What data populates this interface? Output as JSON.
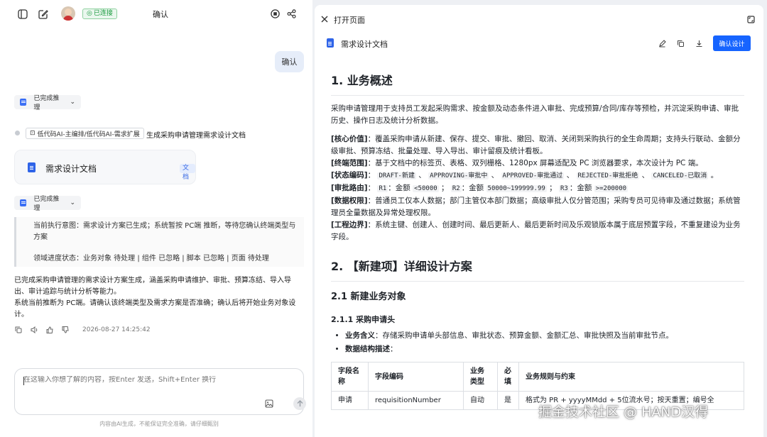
{
  "topbar": {
    "status": "已连接",
    "title": "确认"
  },
  "chat": {
    "user_message": "确认",
    "reasoning_label": "已完成推理",
    "step_tag": "低代码AI-主编排/低代码AI-需求扩展",
    "step_text": "生成采购申请管理需求设计文档",
    "doc_card": {
      "name": "需求设计文档",
      "type": "文档"
    },
    "quote_line1": "当前执行意图：需求设计方案已生成；系统暂按 PC端 推断，等待您确认终端类型与",
    "quote_line2": "方案",
    "quote_line3": "领域进度状态：业务对象 待处理 | 组件 已忽略 | 脚本 已忽略 | 页面 待处理",
    "answer_line1": "已完成采购申请管理的需求设计方案生成，涵盖采购申请维护、审批、预算冻结、导入导",
    "answer_line2": "出、审计追踪与统计分析等能力。",
    "answer_line3": "系统当前推断为 PC端。请确认该终端类型及需求方案是否准确；确认后将开始业务对象设",
    "answer_line4": "计。",
    "timestamp": "2026-08-27 14:25:42"
  },
  "input": {
    "placeholder": "在这输入你想了解的内容，按Enter 发送，Shift+Enter 换行",
    "disclaimer": "内容由AI生成，不能保证完全准确，请仔细甄别"
  },
  "panel": {
    "title": "打开页面",
    "doc_name": "需求设计文档",
    "confirm_button": "确认设计"
  },
  "doc": {
    "h1_overview": "1. 业务概述",
    "overview_text": "采购申请管理用于支持员工发起采购需求、按金额及动态条件进入审批、完成预算/合同/库存等预检，并沉淀采购申请、审批历史、操作日志及统计分析数据。",
    "core_label": "[核心价值]",
    "core_text": "：覆盖采购申请从新建、保存、提交、审批、撤回、取消、关闭到采购执行的全生命周期；支持头行联动、金额分级审批、预算冻结、批量处理、导入导出、审计留痕及统计看板。",
    "terminal_label": "[终端范围]",
    "terminal_text": "：基于文档中的标签页、表格、双列栅格、1280px 屏幕适配及 PC 浏览器要求，本次设计为 PC 端。",
    "status_label": "[状态编码]",
    "status_sep": "：",
    "status_codes": [
      "DRAFT-新建",
      "APPROVING-审批中",
      "APPROVED-审批通过",
      "REJECTED-审批拒绝",
      "CANCELED-已取消"
    ],
    "route_label": "[审批路由]",
    "route_sep": "：",
    "route_r1": "R1",
    "route_r1_amount": "<50000",
    "route_r2": "R2",
    "route_r2_amount": "50000~199999.99",
    "route_r3": "R3",
    "route_r3_amount": ">=200000",
    "route_amount_word": "：金额",
    "perm_label": "[数据权限]",
    "perm_text": "：普通员工仅本人数据；部门主管仅本部门数据；高级审批人仅分管范围；采购专员可见待审及通过数据；系统管理员全量数据及异常处理权限。",
    "boundary_label": "[工程边界]",
    "boundary_text": "：系统主键、创建人、创建时间、最后更新人、最后更新时间及乐观锁版本属于底层预置字段，不重复建设为业务字段。",
    "h1_detail": "2. 【新建项】详细设计方案",
    "h2_object": "2.1 新建业务对象",
    "h3_req": "2.1.1 采购申请头",
    "bullet1_label": "业务含义",
    "bullet1_text": "：存储采购申请单头部信息、审批状态、预算金额、金额汇总、审批快照及当前审批节点。",
    "bullet2_label": "数据结构描述",
    "bullet2_text": "：",
    "table_headers": [
      "字段名称",
      "字段编码",
      "业务类型",
      "必填",
      "业务规则与约束"
    ],
    "table_row": [
      "申请",
      "requisitionNumber",
      "自动",
      "是",
      "格式为 PR + yyyyMMdd + 5位流水号；按天重置；编号全"
    ]
  },
  "watermark": "掘金技术社区 @ HAND汉得"
}
